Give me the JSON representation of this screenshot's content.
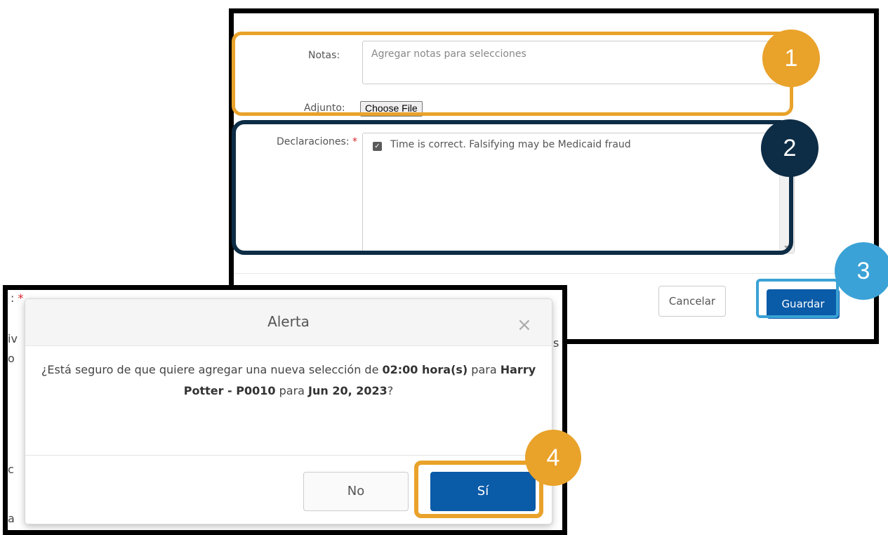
{
  "form": {
    "notes_label": "Notas:",
    "notes_placeholder": "Agregar notas para selecciones",
    "attachment_label": "Adjunto:",
    "attachment_button": "Choose File",
    "declarations_label": "Declaraciones:",
    "required_mark": "*",
    "declaration_text": "Time is correct. Falsifying may be Medicaid fraud",
    "declaration_checked": true,
    "cancel_label": "Cancelar",
    "save_label": "Guardar"
  },
  "background_fragments": [
    ": ",
    "*",
    "iv",
    "o",
    "s",
    "c",
    "a"
  ],
  "alert": {
    "title": "Alerta",
    "close_glyph": "×",
    "msg_part1": "¿Está seguro de que quiere agregar una nueva selección de ",
    "msg_hours": "02:00 hora(s)",
    "msg_part2": " para ",
    "msg_provider": "Harry Potter - P0010",
    "msg_part3": " para ",
    "msg_date": "Jun 20, 2023",
    "msg_part4": "?",
    "no_label": "No",
    "yes_label": "Sí"
  },
  "callouts": {
    "step1": "1",
    "step2": "2",
    "step3": "3",
    "step4": "4"
  },
  "colors": {
    "callout_orange": "#e9a22a",
    "callout_navy": "#0d2c45",
    "callout_blue": "#3aa2d6",
    "primary_button": "#0a5ba8"
  }
}
